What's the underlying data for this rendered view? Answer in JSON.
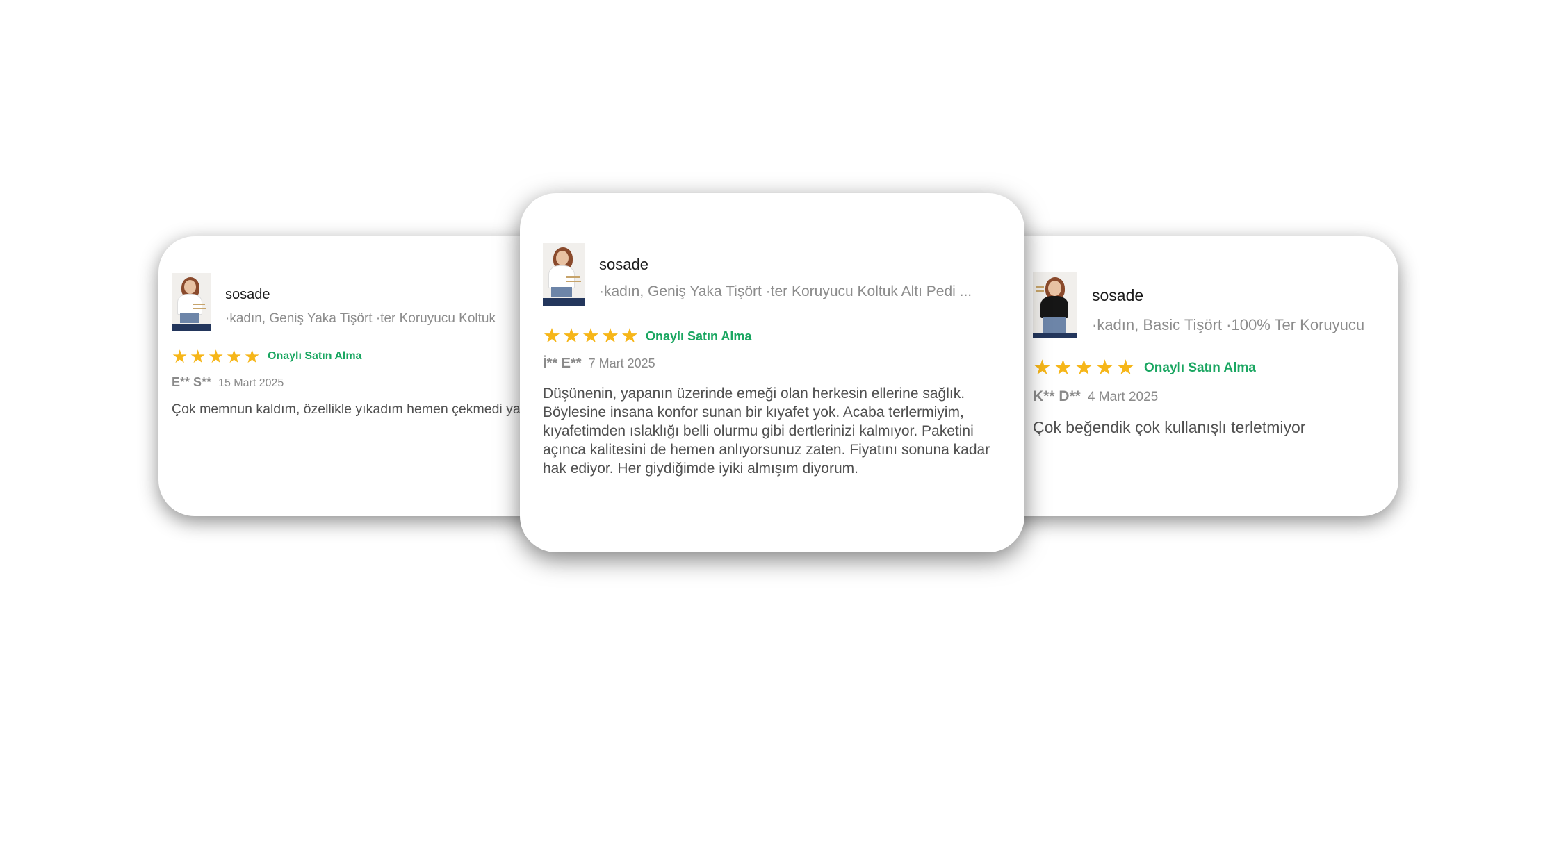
{
  "reviews": [
    {
      "brand": "sosade",
      "product": "·kadın, Geniş Yaka Tişört ·ter Koruyucu Koltuk",
      "verified_label": "Onaylı Satın Alma",
      "rating": 5,
      "reviewer": "E** S**",
      "date": "15 Mart 2025",
      "comment": "Çok memnun kaldım, özellikle yıkadım hemen çekmedi yapmadı",
      "thumb_icon": "product-thumbnail-white-tshirt"
    },
    {
      "brand": "sosade",
      "product": "·kadın, Geniş Yaka Tişört ·ter Koruyucu Koltuk Altı Pedi ...",
      "verified_label": "Onaylı Satın Alma",
      "rating": 5,
      "reviewer": "İ** E**",
      "date": "7 Mart 2025",
      "comment": "Düşünenin, yapanın üzerinde emeği olan herkesin ellerine sağlık. Böylesine insana konfor sunan bir kıyafet yok. Acaba terlermiyim, kıyafetimden ıslaklığı belli olurmu gibi dertlerinizi kalmıyor. Paketini açınca kalitesini de hemen anlıyorsunuz zaten. Fiyatını sonuna kadar hak ediyor. Her giydiğimde iyiki almışım diyorum.",
      "thumb_icon": "product-thumbnail-white-tshirt"
    },
    {
      "brand": "sosade",
      "product": "·kadın, Basic Tişört ·100% Ter Koruyucu",
      "verified_label": "Onaylı Satın Alma",
      "rating": 5,
      "reviewer": "K** D**",
      "date": "4 Mart 2025",
      "comment": "Çok beğendik çok kullanışlı terletmiyor",
      "thumb_icon": "product-thumbnail-black-tshirt"
    }
  ],
  "colors": {
    "star": "#f6b619",
    "verified": "#1aa661",
    "muted_text": "#8a8a8a",
    "body_text": "#505050",
    "brand_text": "#1b1b1b"
  },
  "star_glyph": "★"
}
